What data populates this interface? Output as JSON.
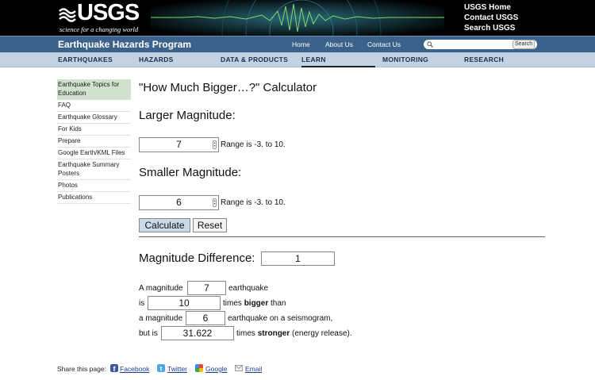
{
  "header": {
    "logo_text": "USGS",
    "logo_tagline": "science for a changing world",
    "top_links": [
      "USGS Home",
      "Contact USGS",
      "Search USGS"
    ]
  },
  "program_bar": {
    "title": "Earthquake Hazards Program",
    "links": [
      "Home",
      "About Us",
      "Contact Us"
    ],
    "search_placeholder": "",
    "search_button": "Search"
  },
  "nav": {
    "items": [
      "EARTHQUAKES",
      "HAZARDS",
      "DATA & PRODUCTS",
      "LEARN",
      "MONITORING",
      "RESEARCH"
    ],
    "active": "LEARN"
  },
  "sidebar": {
    "items": [
      "Earthquake Topics for Education",
      "FAQ",
      "Earthquake Glossary",
      "For Kids",
      "Prepare",
      "Google Earth/KML Files",
      "Earthquake Summary Posters",
      "Photos",
      "Publications"
    ]
  },
  "calculator": {
    "title": "\"How Much Bigger…?\" Calculator",
    "larger_label": "Larger Magnitude:",
    "larger_value": "7",
    "smaller_label": "Smaller Magnitude:",
    "smaller_value": "6",
    "range_note": "Range is -3. to 10.",
    "calculate_button": "Calculate",
    "reset_button": "Reset",
    "difference_label": "Magnitude Difference:",
    "difference_value": "1"
  },
  "result": {
    "line1_prefix": "A magnitude",
    "line1_value": "7",
    "line1_suffix": "earthquake",
    "line2_prefix": "is",
    "line2_value": "10",
    "line2_times": "times",
    "line2_bold": "bigger",
    "line2_suffix": "than",
    "line3_prefix": "a magnitude",
    "line3_value": "6",
    "line3_suffix": "earthquake on a seismogram,",
    "line4_prefix": "but is",
    "line4_value": "31.622",
    "line4_times": "times",
    "line4_bold": "stronger",
    "line4_suffix": "(energy release)."
  },
  "share": {
    "label": "Share this page:",
    "links": [
      "Facebook",
      "Twitter",
      "Google",
      "Email"
    ]
  },
  "colors": {
    "program_bar": "#3b628a",
    "nav_bar": "#c3d2e3",
    "sidebar_active": "#cfe2cc",
    "calc_button": "#c9d9e8",
    "link": "#1b3f8f"
  }
}
